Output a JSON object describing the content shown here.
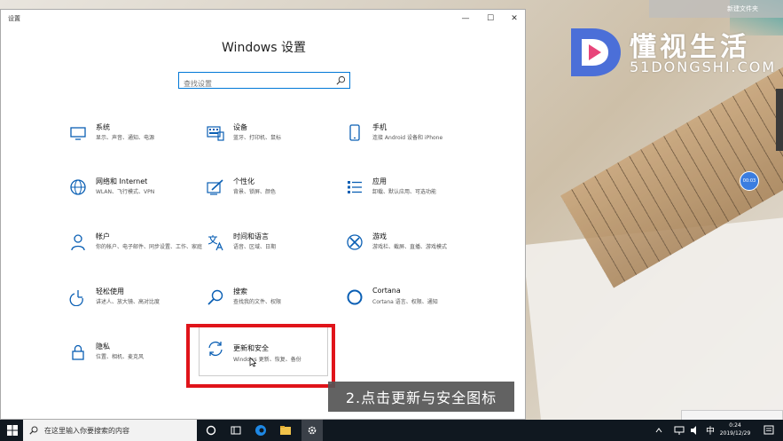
{
  "window": {
    "title": "设置",
    "minimize": "—",
    "maximize": "☐",
    "close": "✕"
  },
  "page_title": "Windows 设置",
  "search": {
    "placeholder": "查找设置"
  },
  "tiles": [
    {
      "name": "系统",
      "desc": "显示、声音、通知、电源"
    },
    {
      "name": "设备",
      "desc": "蓝牙、打印机、鼠标"
    },
    {
      "name": "手机",
      "desc": "连接 Android 设备和 iPhone"
    },
    {
      "name": "网络和 Internet",
      "desc": "WLAN、飞行模式、VPN"
    },
    {
      "name": "个性化",
      "desc": "背景、锁屏、颜色"
    },
    {
      "name": "应用",
      "desc": "卸载、默认应用、可选功能"
    },
    {
      "name": "帐户",
      "desc": "你的帐户、电子邮件、同步设置、工作、家庭"
    },
    {
      "name": "时间和语言",
      "desc": "语音、区域、日期"
    },
    {
      "name": "游戏",
      "desc": "游戏栏、截屏、直播、游戏模式"
    },
    {
      "name": "轻松使用",
      "desc": "讲述人、放大镜、高对比度"
    },
    {
      "name": "搜索",
      "desc": "查找我的文件、权限"
    },
    {
      "name": "Cortana",
      "desc": "Cortana 语言、权限、通知"
    },
    {
      "name": "隐私",
      "desc": "位置、相机、麦克风"
    },
    {
      "name": "更新和安全",
      "desc": "Windows 更新、恢复、备份"
    }
  ],
  "caption": "2.点击更新与安全图标",
  "desktop": {
    "new_folder": "新建文件夹",
    "logo_cn": "懂视生活",
    "logo_en": "51DONGSHI.COM",
    "time_bubble": "00:03"
  },
  "taskbar": {
    "search_placeholder": "在这里输入你要搜索的内容",
    "time": "0:24",
    "date": "2019/12/29"
  },
  "colors": {
    "accent": "#0078d7",
    "highlight": "#e0141a",
    "taskbar": "#101820"
  }
}
